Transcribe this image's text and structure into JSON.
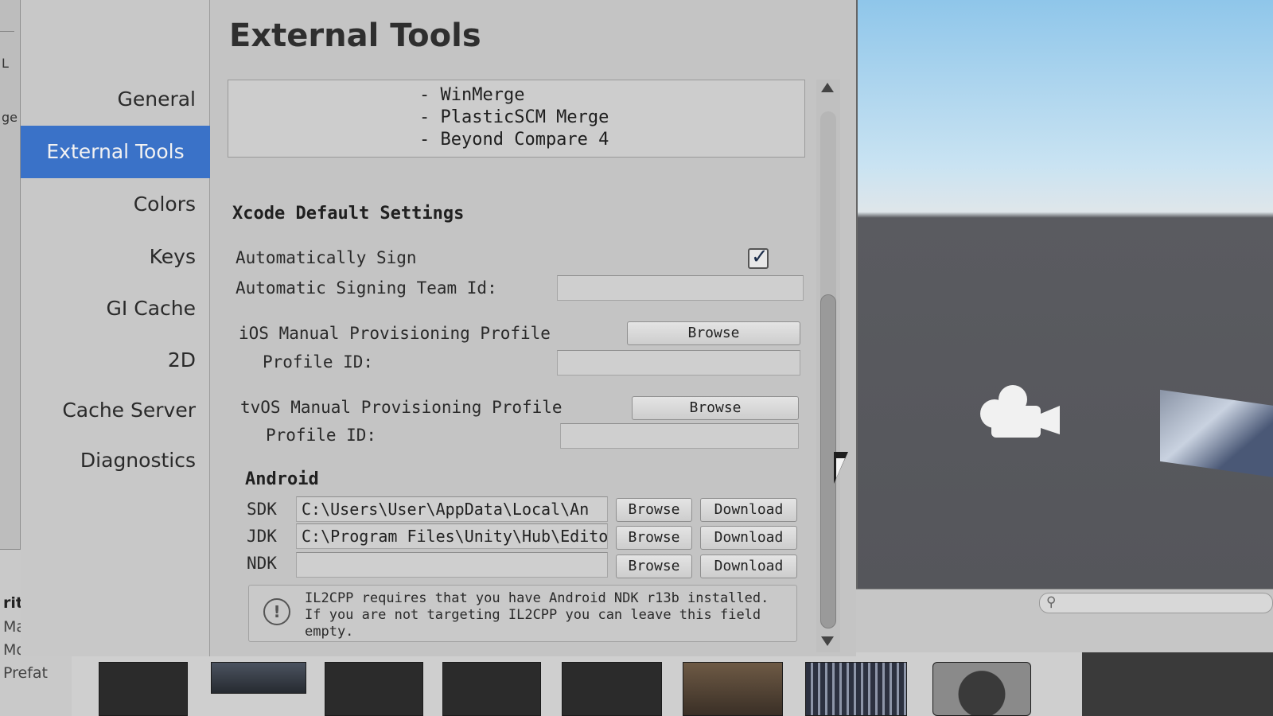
{
  "window": {
    "title": "External Tools"
  },
  "left_edge": {
    "text_ge": "ge",
    "text_l": "L"
  },
  "sidebar": {
    "items": [
      {
        "label": "General"
      },
      {
        "label": "External Tools",
        "active": true
      },
      {
        "label": "Colors"
      },
      {
        "label": "Keys"
      },
      {
        "label": "GI Cache"
      },
      {
        "label": "2D"
      },
      {
        "label": "Cache Server"
      },
      {
        "label": "Diagnostics"
      }
    ]
  },
  "merge_tools": {
    "lines": [
      "- WinMerge",
      "- PlasticSCM Merge",
      "- Beyond Compare 4"
    ]
  },
  "xcode": {
    "title": "Xcode Default Settings",
    "auto_sign_label": "Automatically Sign",
    "auto_sign_checked": true,
    "team_id_label": "Automatic Signing Team Id:",
    "team_id_value": "",
    "ios_profile_label": "iOS Manual Provisioning Profile",
    "ios_browse_label": "Browse",
    "ios_profile_id_label": "Profile ID:",
    "ios_profile_id_value": "",
    "tvos_profile_label": "tvOS Manual Provisioning Profile",
    "tvos_browse_label": "Browse",
    "tvos_profile_id_label": "Profile ID:",
    "tvos_profile_id_value": ""
  },
  "android": {
    "title": "Android",
    "rows": [
      {
        "label": "SDK",
        "value": "C:\\Users\\User\\AppData\\Local\\An",
        "browse": "Browse",
        "download": "Download"
      },
      {
        "label": "JDK",
        "value": "C:\\Program Files\\Unity\\Hub\\Edito",
        "browse": "Browse",
        "download": "Download"
      },
      {
        "label": "NDK",
        "value": "",
        "browse": "Browse",
        "download": "Download"
      }
    ],
    "help_icon": "!",
    "help_lines": [
      "IL2CPP requires that you have Android NDK r13b installed.",
      "If you are not targeting IL2CPP you can leave this field",
      "empty."
    ]
  },
  "project_panel": {
    "items": [
      "rites",
      "Materi",
      "Model",
      "Prefat"
    ]
  },
  "scene": {
    "search_icon": "search-icon",
    "camera_icon": "camera-icon"
  },
  "colors": {
    "accent": "#3a72c8",
    "panel_bg": "#c4c4c4",
    "sky_top": "#8fc6ea",
    "ground": "#55565b"
  }
}
